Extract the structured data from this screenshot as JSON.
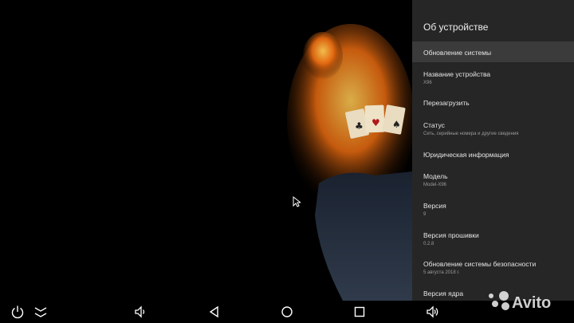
{
  "settings_panel": {
    "title": "Об устройстве",
    "items": [
      {
        "title": "Обновление системы",
        "subtitle": ""
      },
      {
        "title": "Название устройства",
        "subtitle": "X96"
      },
      {
        "title": "Перезагрузить",
        "subtitle": ""
      },
      {
        "title": "Статус",
        "subtitle": "Сеть, серийные номера и другие сведения"
      },
      {
        "title": "Юридическая информация",
        "subtitle": ""
      },
      {
        "title": "Модель",
        "subtitle": "Model-X96"
      },
      {
        "title": "Версия",
        "subtitle": "9"
      },
      {
        "title": "Версия прошивки",
        "subtitle": "0.2.8"
      },
      {
        "title": "Обновление системы безопасности",
        "subtitle": "5 августа 2018 г."
      },
      {
        "title": "Версия ядра",
        "subtitle": ""
      }
    ]
  },
  "navbar": {
    "buttons": [
      "power-icon",
      "menu-collapse-icon",
      "volume-down-icon",
      "back-icon",
      "home-icon",
      "recents-icon",
      "volume-up-icon"
    ]
  },
  "watermark": {
    "text": "Avito"
  },
  "colors": {
    "panel_bg": "#262626",
    "panel_selected": "#3b3b3b",
    "text": "#e6e6e6",
    "subtext": "#9a9a9a"
  }
}
